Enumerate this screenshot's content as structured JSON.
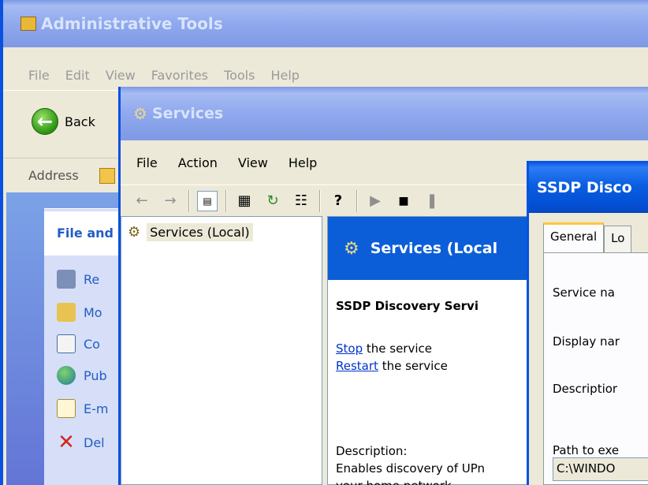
{
  "admin_window": {
    "title": "Administrative Tools",
    "menu": [
      "File",
      "Edit",
      "View",
      "Favorites",
      "Tools",
      "Help"
    ],
    "back_label": "Back",
    "address_label": "Address",
    "tasks_header": "File and",
    "tasks": [
      "Re",
      "Mo",
      "Co",
      "Pub",
      "E-m",
      "Del"
    ]
  },
  "services_window": {
    "title": "Services",
    "menu": [
      "File",
      "Action",
      "View",
      "Help"
    ],
    "tree_node": "Services (Local)",
    "detail_header": "Services (Local",
    "selected_service": "SSDP Discovery Servi",
    "stop_link": "Stop",
    "stop_suffix": " the service",
    "restart_link": "Restart",
    "restart_suffix": " the service",
    "description_label": "Description:",
    "description_line1": "Enables discovery of UPn",
    "description_line2": "your home network."
  },
  "ssdp_dialog": {
    "title": "SSDP Disco",
    "tabs": [
      "General",
      "Lo"
    ],
    "service_name_label": "Service na",
    "display_name_label": "Display nar",
    "description_label": "Descriptior",
    "path_label": "Path to exe",
    "path_value": "C:\\WINDO"
  },
  "colors": {
    "title_active": "#0551d6",
    "title_inactive": "#90a8ee",
    "link": "#0033cc",
    "window_face": "#ece9d8"
  }
}
